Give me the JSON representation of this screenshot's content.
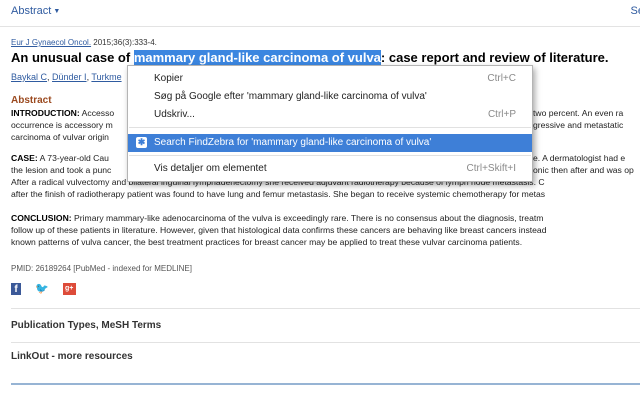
{
  "header": {
    "abstract_label": "Abstract",
    "right_link": "Se"
  },
  "citation": {
    "journal": "Eur J Gynaecol Oncol.",
    "details": " 2015;36(3):333-4."
  },
  "title": {
    "prefix": "An unusual case of ",
    "highlight": "mammary gland-like carcinoma of vulva",
    "suffix": ": case report and review of literature."
  },
  "authors": {
    "a1": "Baykal C",
    "a2": "Dünder I",
    "a3": "Turkme"
  },
  "abstract": {
    "heading": "Abstract",
    "intro_label": "INTRODUCTION:",
    "intro_lines": [
      "Accesso",
      "occurrence is accessory m",
      "carcinoma of vulvar origin"
    ],
    "intro_right_lines": [
      "two percent. An even ra",
      "gressive and metastatic",
      ""
    ],
    "case_label": "CASE:",
    "case_lines": [
      " A 73-year-old Cau",
      "the lesion and took a punc",
      "After a radical vulvectomy and bilateral inguinal lymphadenectomy she received adjuvant radiotherapy because of lymph node metastasis. C",
      "after the finish of radiotherapy patient was found to have lung and femur metastasis. She began to receive systemic chemotherapy for metas"
    ],
    "case_right_lines": [
      "e. A dermatologist had e",
      "onic then after and was op"
    ],
    "conclusion_label": "CONCLUSION:",
    "conclusion_lines": [
      " Primary mammary-like adenocarcinoma of the vulva is exceedingly rare. There is no consensus about the diagnosis, treatm",
      "follow up of these patients in literature. However, given that histological data confirms these cancers are behaving like breast cancers instead",
      "known patterns of vulva cancer, the best treatment practices for breast cancer may be applied to treat these vulvar carcinoma patients."
    ]
  },
  "pmid": "PMID: 26189264 [PubMed - indexed for MEDLINE]",
  "social": {
    "facebook": "f",
    "twitter": "🐦",
    "googleplus": "g+"
  },
  "sections": {
    "publication_types": "Publication Types, MeSH Terms",
    "linkout": "LinkOut - more resources"
  },
  "context_menu": {
    "items": [
      {
        "label": "Kopier",
        "shortcut": "Ctrl+C"
      },
      {
        "label": "Søg på Google efter 'mammary gland-like carcinoma of vulva'",
        "shortcut": ""
      },
      {
        "label": "Udskriv...",
        "shortcut": "Ctrl+P"
      },
      {
        "label": "Search FindZebra for 'mammary gland-like carcinoma of vulva'",
        "shortcut": ""
      },
      {
        "label": "Vis detaljer om elementet",
        "shortcut": "Ctrl+Skift+I"
      }
    ],
    "selected_index": 3
  },
  "colors": {
    "link": "#2f5ba0",
    "highlight": "#3b86e0",
    "menu_selected": "#3e7fd7",
    "abstract_heading": "#9b4a20"
  }
}
